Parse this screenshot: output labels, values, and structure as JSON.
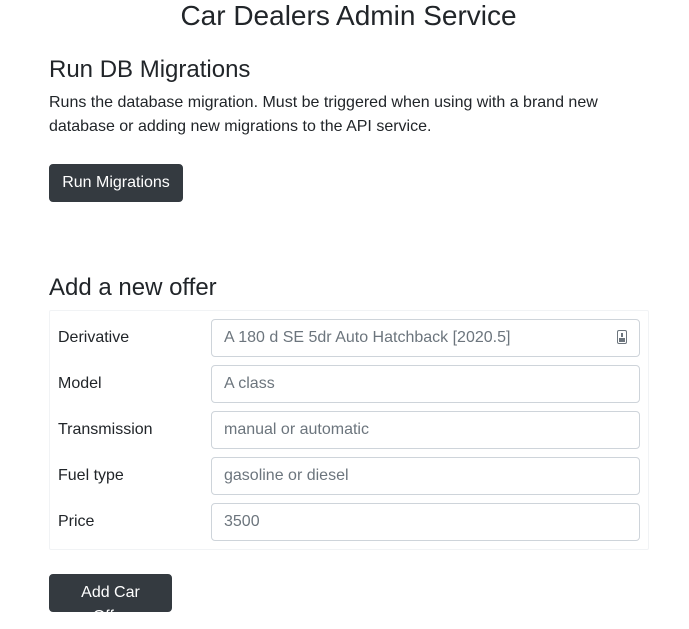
{
  "header": {
    "title": "Car Dealers Admin Service"
  },
  "migrations": {
    "title": "Run DB Migrations",
    "description": "Runs the database migration. Must be triggered when using with a brand new database or adding new migrations to the API service.",
    "button_label": "Run Migrations"
  },
  "offer": {
    "title": "Add a new offer",
    "fields": [
      {
        "label": "Derivative",
        "placeholder": "A 180 d SE 5dr Auto Hatchback [2020.5]"
      },
      {
        "label": "Model",
        "placeholder": "A class"
      },
      {
        "label": "Transmission",
        "placeholder": "manual or automatic"
      },
      {
        "label": "Fuel type",
        "placeholder": "gasoline or diesel"
      },
      {
        "label": "Price",
        "placeholder": "3500"
      }
    ],
    "button_label": "Add Car Offer"
  },
  "icons": {
    "derivative_field_icon": "autofill-contact-card-icon"
  }
}
